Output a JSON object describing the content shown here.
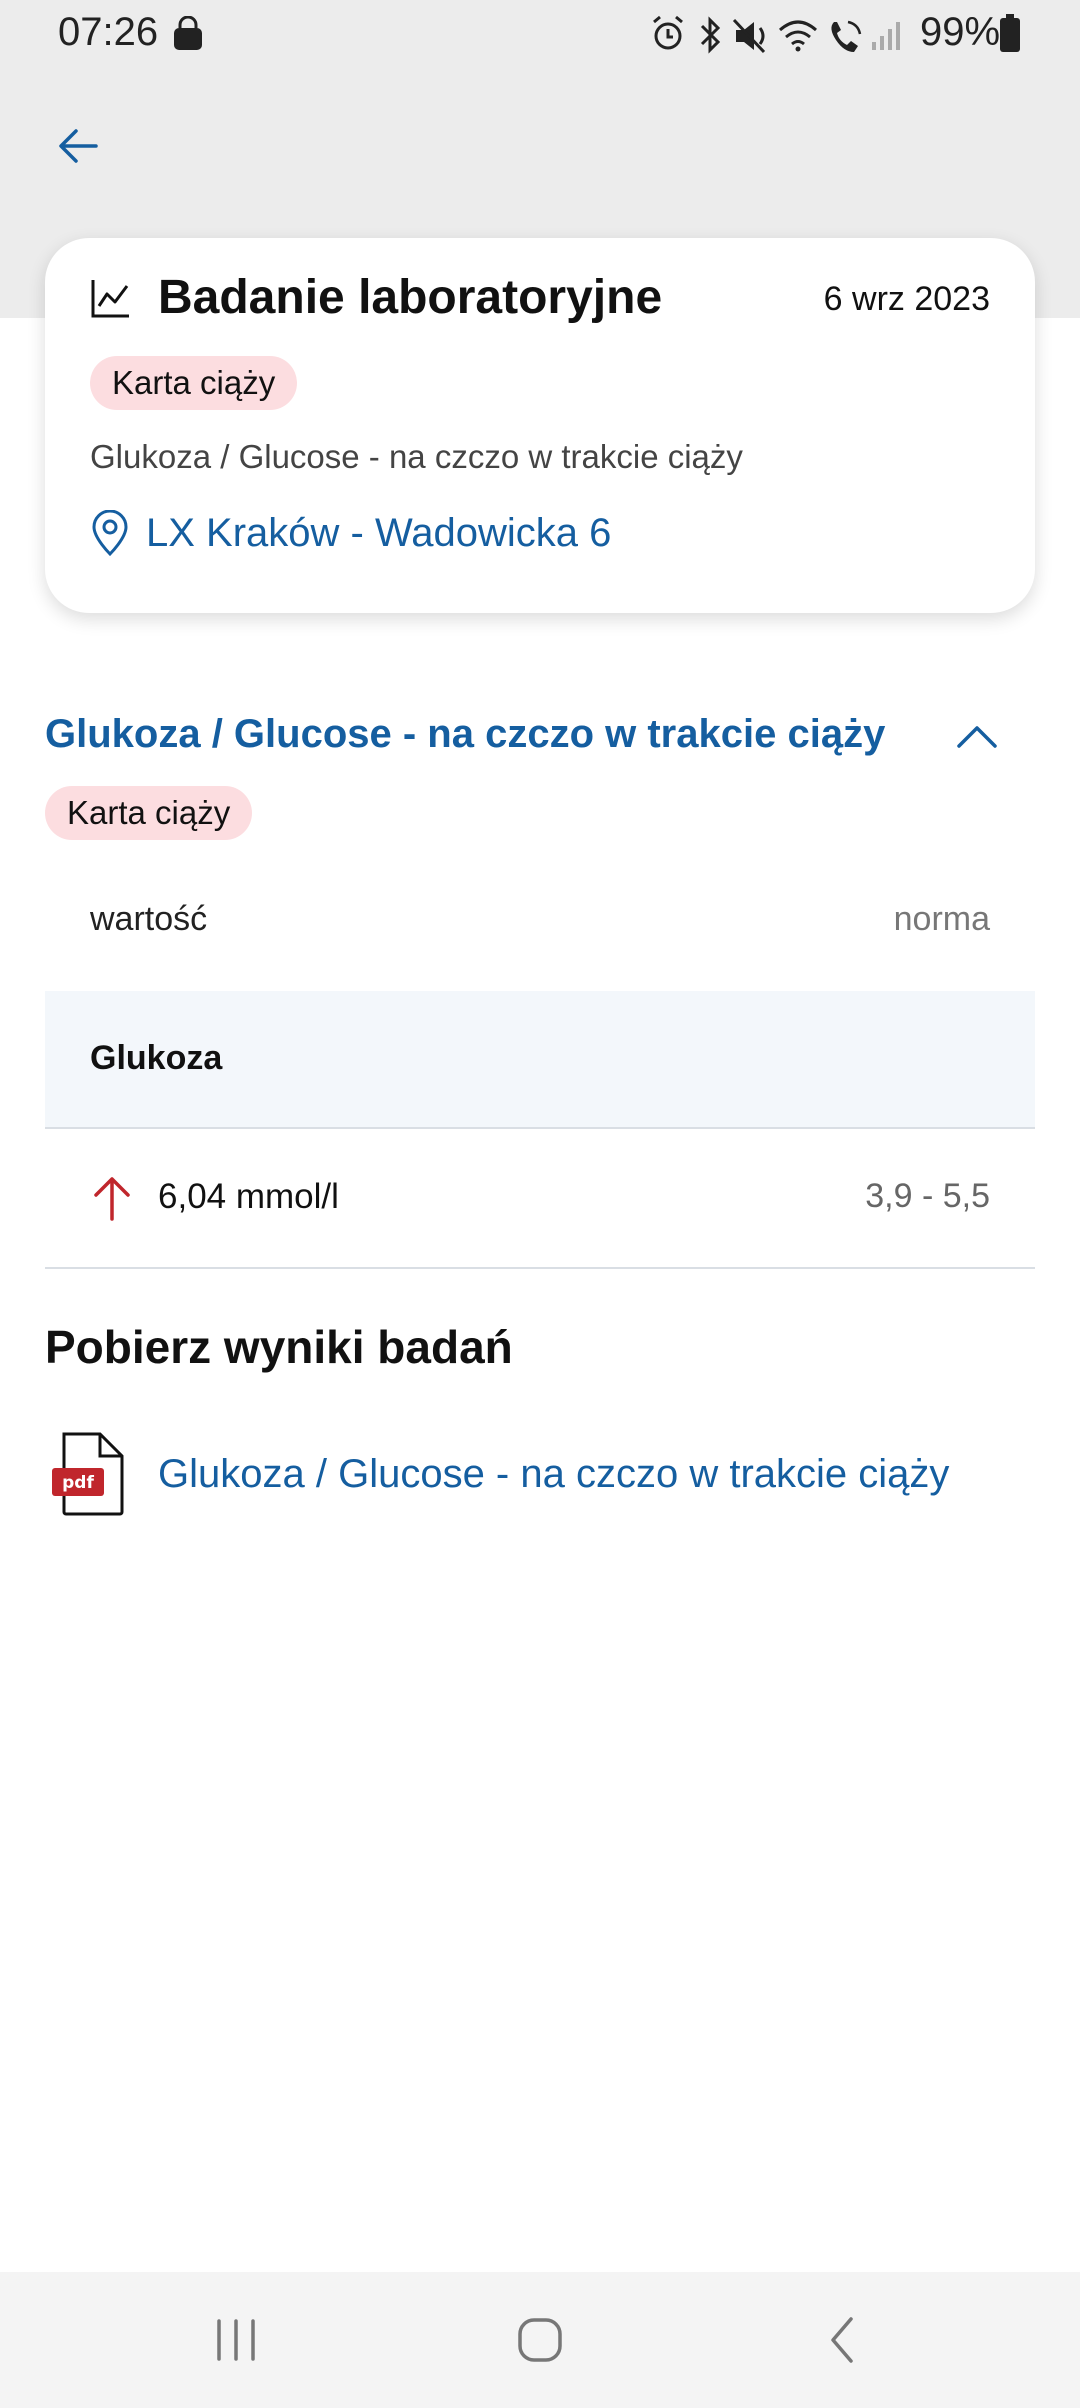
{
  "status_bar": {
    "time": "07:26",
    "battery_percent": "99%",
    "icons": [
      "shopping-bag-icon",
      "alarm-icon",
      "bluetooth-icon",
      "mute-icon",
      "wifi-icon",
      "wifi-calling-icon",
      "signal-icon",
      "battery-icon"
    ]
  },
  "header_card": {
    "title": "Badanie laboratoryjne",
    "date": "6 wrz 2023",
    "badge": "Karta ciąży",
    "subtitle": "Glukoza / Glucose - na czczo w trakcie ciąży",
    "location": "LX Kraków - Wadowicka 6"
  },
  "result_section": {
    "title": "Glukoza / Glucose - na czczo w trakcie ciąży",
    "badge": "Karta ciąży",
    "expanded": true,
    "column_value": "wartość",
    "column_norm": "norma",
    "group_label": "Glukoza",
    "result": {
      "value": "6,04 mmol/l",
      "norm": "3,9 - 5,5",
      "trend": "up"
    }
  },
  "downloads": {
    "title": "Pobierz wyniki badań",
    "files": [
      {
        "label": "Glukoza / Glucose - na czczo w trakcie ciąży",
        "file_type": "pdf"
      }
    ]
  },
  "colors": {
    "accent": "#155ea0",
    "badge_bg": "#fcdde0",
    "alert_red": "#c0262c"
  }
}
